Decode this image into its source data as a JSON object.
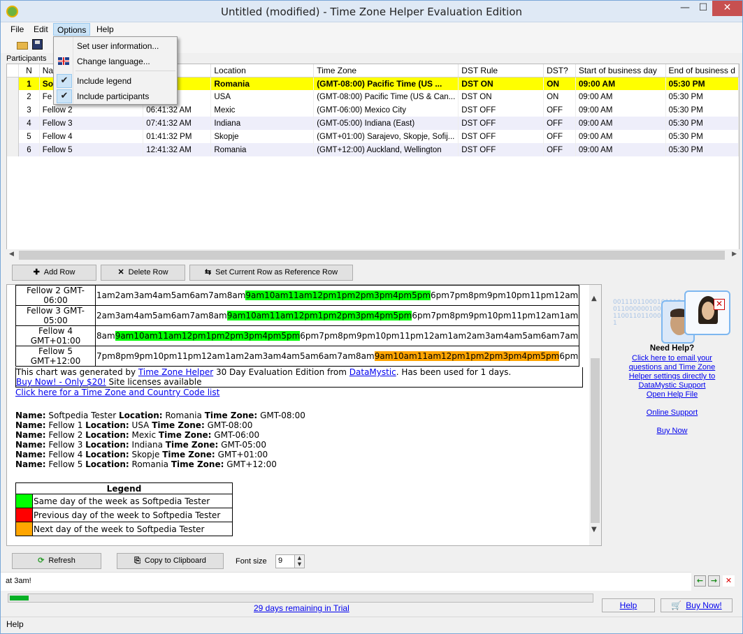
{
  "window": {
    "title": "Untitled (modified) - Time Zone Helper Evaluation Edition",
    "min_glyph": "—",
    "max_glyph": "☐",
    "close_glyph": "✕"
  },
  "menu": {
    "file": "File",
    "edit": "Edit",
    "options": "Options",
    "help": "Help"
  },
  "options_menu": {
    "set_user_info": "Set user information...",
    "change_language": "Change language...",
    "include_legend": "Include legend",
    "include_participants": "Include participants",
    "include_legend_checked": true,
    "include_participants_checked": true
  },
  "participants_label": "Participants",
  "grid": {
    "headers": [
      "N",
      "Na",
      "Location",
      "Time Zone",
      "DST Rule",
      "DST?",
      "Start of business day",
      "End of business d"
    ],
    "header_time_hidden": "",
    "rows": [
      {
        "n": "1",
        "name": "So",
        "time": "32 AM",
        "location": "Romania",
        "tz": "(GMT-08:00) Pacific Time (US ...",
        "rule": "DST ON",
        "dst": "ON",
        "start": "09:00 AM",
        "end": "05:30 PM"
      },
      {
        "n": "2",
        "name": "Fe",
        "time": "32 AM",
        "location": "USA",
        "tz": "(GMT-08:00) Pacific Time (US & Can...",
        "rule": "DST ON",
        "dst": "ON",
        "start": "09:00 AM",
        "end": "05:30 PM"
      },
      {
        "n": "3",
        "name": "Fellow 2",
        "time": "06:41:32 AM",
        "location": "Mexic",
        "tz": "(GMT-06:00) Mexico City",
        "rule": "DST OFF",
        "dst": "OFF",
        "start": "09:00 AM",
        "end": "05:30 PM"
      },
      {
        "n": "4",
        "name": "Fellow 3",
        "time": "07:41:32 AM",
        "location": "Indiana",
        "tz": "(GMT-05:00) Indiana (East)",
        "rule": "DST OFF",
        "dst": "OFF",
        "start": "09:00 AM",
        "end": "05:30 PM"
      },
      {
        "n": "5",
        "name": "Fellow 4",
        "time": "01:41:32 PM",
        "location": "Skopje",
        "tz": "(GMT+01:00) Sarajevo, Skopje, Sofij...",
        "rule": "DST OFF",
        "dst": "OFF",
        "start": "09:00 AM",
        "end": "05:30 PM"
      },
      {
        "n": "6",
        "name": "Fellow 5",
        "time": "12:41:32 AM",
        "location": "Romania",
        "tz": "(GMT+12:00) Auckland, Wellington",
        "rule": "DST OFF",
        "dst": "OFF",
        "start": "09:00 AM",
        "end": "05:30 PM"
      }
    ]
  },
  "buttons": {
    "add_row": "Add Row",
    "delete_row": "Delete Row",
    "set_reference": "Set Current Row as Reference Row",
    "refresh": "Refresh",
    "copy_clipboard": "Copy to Clipboard"
  },
  "chart": {
    "rows": [
      {
        "name": "Fellow 2 GMT-06:00",
        "pre": "1am2am3am4am5am6am7am8am",
        "hl": "9am10am11am12pm1pm2pm3pm4pm5pm",
        "post": "6pm7pm8pm9pm10pm11pm12am",
        "hl_color": "green"
      },
      {
        "name": "Fellow 3 GMT-05:00",
        "pre": "2am3am4am5am6am7am8am",
        "hl": "9am10am11am12pm1pm2pm3pm4pm5pm",
        "post": "6pm7pm8pm9pm10pm11pm12am1am",
        "hl_color": "green"
      },
      {
        "name": "Fellow 4 GMT+01:00",
        "pre": "8am",
        "hl": "9am10am11am12pm1pm2pm3pm4pm5pm",
        "post": "6pm7pm8pm9pm10pm11pm12am1am2am3am4am5am6am7am",
        "hl_color": "green"
      },
      {
        "name": "Fellow 5 GMT+12:00",
        "pre": "7pm8pm9pm10pm11pm12am1am2am3am4am5am6am7am8am",
        "hl": "9am10am11am12pm1pm2pm3pm4pm5pm",
        "post": "6pm",
        "hl_color": "orange"
      }
    ],
    "notice_pre": "This chart was generated by ",
    "notice_link1": "Time Zone Helper",
    "notice_mid": " 30 Day Evaluation Edition from ",
    "notice_link2": "DataMystic",
    "notice_post": ". Has been used for 1 days.",
    "buy_link": "Buy Now! - Only $20!",
    "buy_post": " Site licenses available",
    "code_list_link": "Click here for a Time Zone and Country Code list"
  },
  "details": {
    "name_label": "Name:",
    "location_label": "Location:",
    "tz_label": "Time Zone:",
    "people": [
      {
        "name": "Softpedia Tester",
        "location": "Romania",
        "tz": "GMT-08:00"
      },
      {
        "name": "Fellow 1",
        "location": "USA",
        "tz": "GMT-08:00"
      },
      {
        "name": "Fellow 2",
        "location": "Mexic",
        "tz": "GMT-06:00"
      },
      {
        "name": "Fellow 3",
        "location": "Indiana",
        "tz": "GMT-05:00"
      },
      {
        "name": "Fellow 4",
        "location": "Skopje",
        "tz": "GMT+01:00"
      },
      {
        "name": "Fellow 5",
        "location": "Romania",
        "tz": "GMT+12:00"
      }
    ]
  },
  "legend": {
    "title": "Legend",
    "items": [
      {
        "color": "#00ff00",
        "label": "Same day of the week as Softpedia Tester"
      },
      {
        "color": "#ff0000",
        "label": "Previous day of the week to Softpedia Tester"
      },
      {
        "color": "#ffa500",
        "label": "Next day of the week to Softpedia Tester"
      }
    ]
  },
  "help_panel": {
    "digits": "0011101100010111001100000010001000110011011000010111",
    "need_help": "Need Help?",
    "email_link": "Click here to email your questions and Time Zone Helper settings directly to DataMystic Support",
    "open_help": "Open Help File",
    "online_support": "Online Support",
    "buy_now": "Buy Now"
  },
  "font_size": {
    "label": "Font size",
    "value": "9"
  },
  "message": "at 3am!",
  "progress": {
    "fraction": 0.033
  },
  "trial_text": "29 days remaining in Trial",
  "bottom_buttons": {
    "help": "Help",
    "buy_now": "Buy Now!"
  },
  "status": "Help",
  "colors": {
    "reference_row": "#ffff00",
    "same_day": "#00ff00",
    "next_day": "#ffa500",
    "previous_day": "#ff0000",
    "link": "#0000ee"
  }
}
